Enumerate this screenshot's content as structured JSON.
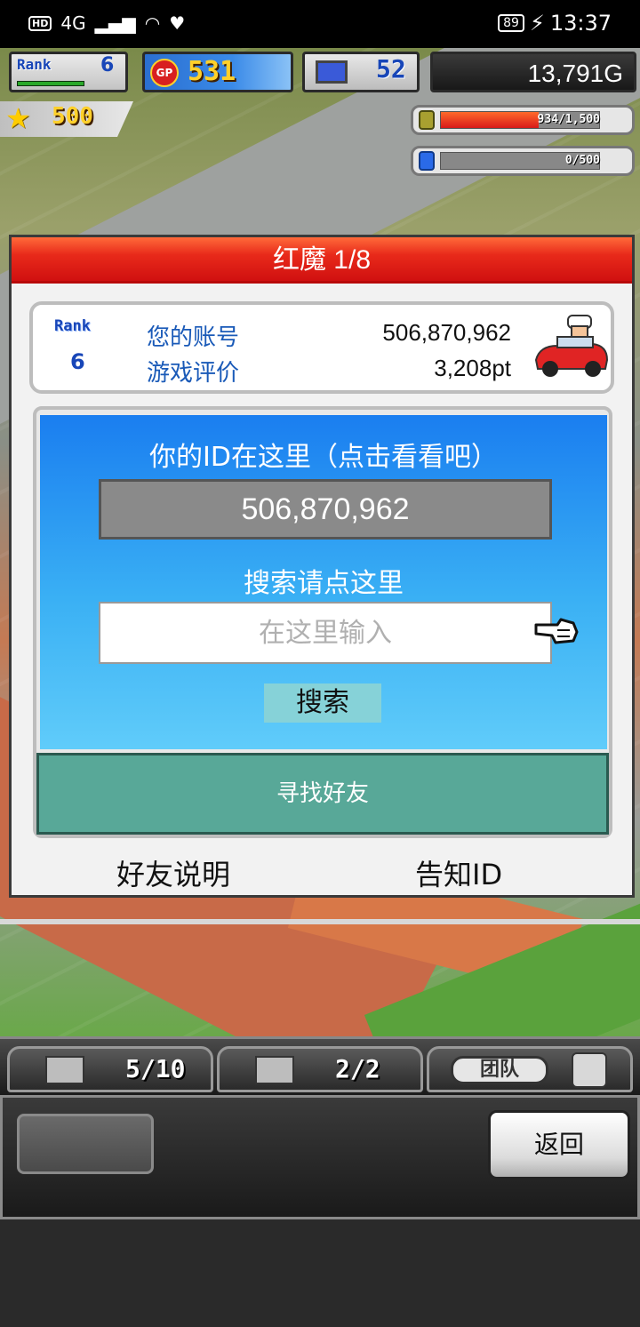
{
  "status_bar": {
    "network": "4G",
    "battery": "89",
    "time": "13:37"
  },
  "hud": {
    "rank_label": "Rank",
    "rank_value": "6",
    "gp_icon": "GP",
    "gp_value": "531",
    "pc_value": "52",
    "money": "13,791G",
    "star_value": "500",
    "gas_meter": {
      "text": "934/1,500",
      "fill_fraction": 0.62
    },
    "water_meter": {
      "text": "0/500",
      "fill_fraction": 0.0
    }
  },
  "dialog": {
    "title": "红魔 1/8",
    "profile": {
      "rank_label": "Rank",
      "rank_value": "6",
      "account_label": "您的账号",
      "account_value": "506,870,962",
      "rating_label": "游戏评价",
      "rating_value": "3,208pt"
    },
    "id_section": {
      "heading": "你的ID在这里（点击看看吧）",
      "id_value": "506,870,962",
      "search_heading": "搜索请点这里",
      "search_placeholder": "在这里输入",
      "search_button": "搜索"
    },
    "find_friend_button": "寻找好友",
    "friend_help_link": "好友说明",
    "notify_id_link": "告知ID"
  },
  "bottom_tabs": {
    "storage_count": "5/10",
    "garage_count": "2/2",
    "team_label": "团队"
  },
  "bottom_panel": {
    "back_button": "返回"
  },
  "icons": [
    "star-icon",
    "gp-coin-icon",
    "computer-icon",
    "gas-tank-icon",
    "water-tank-icon",
    "chef-car-icon",
    "pointer-hand-icon",
    "crate-icon",
    "garage-car-icon",
    "worker-face-icon"
  ],
  "colors": {
    "title_red": "#e82a1a",
    "id_panel_blue": "#1a7ef0",
    "find_friend_green": "#58a898",
    "search_button_teal": "#86d2d8"
  }
}
